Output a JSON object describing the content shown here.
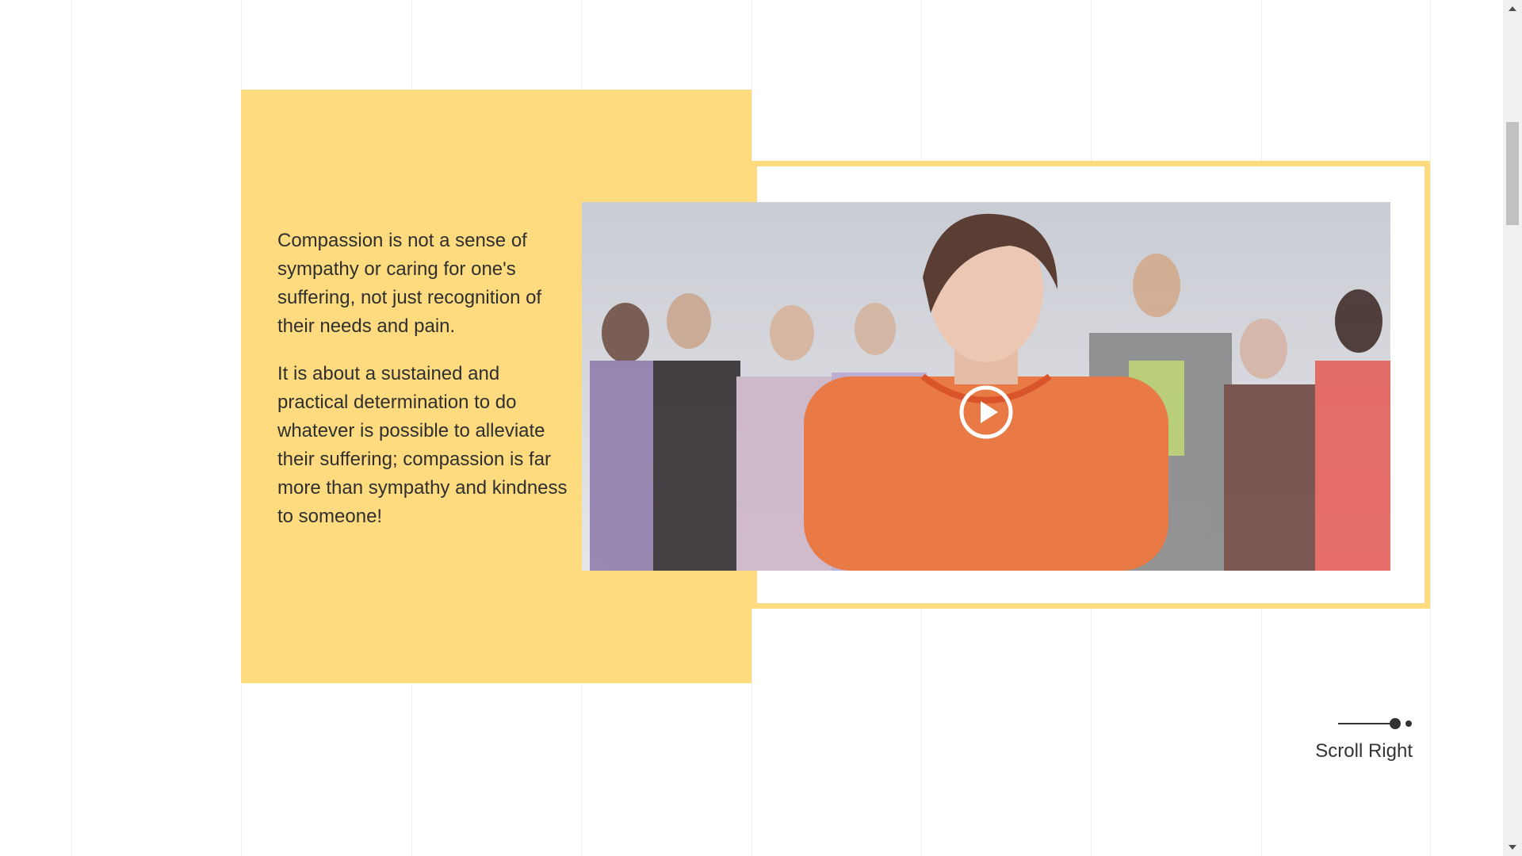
{
  "content": {
    "paragraphs": [
      "Compassion is not a sense of sympathy or caring for one's suffering, not just recognition of their needs and pain.",
      "It is about a sustained and practical determination to do whatever is possible to alleviate their suffering; compassion is far more than sympathy and kindness to someone!"
    ]
  },
  "video": {
    "thumbnail_description_icon": "play-icon"
  },
  "navigation": {
    "scroll_right_label": "Scroll Right"
  },
  "colors": {
    "accent_yellow": "#fddb7e",
    "text": "#2f2f2f",
    "shirt_orange": "#ea7a45"
  }
}
